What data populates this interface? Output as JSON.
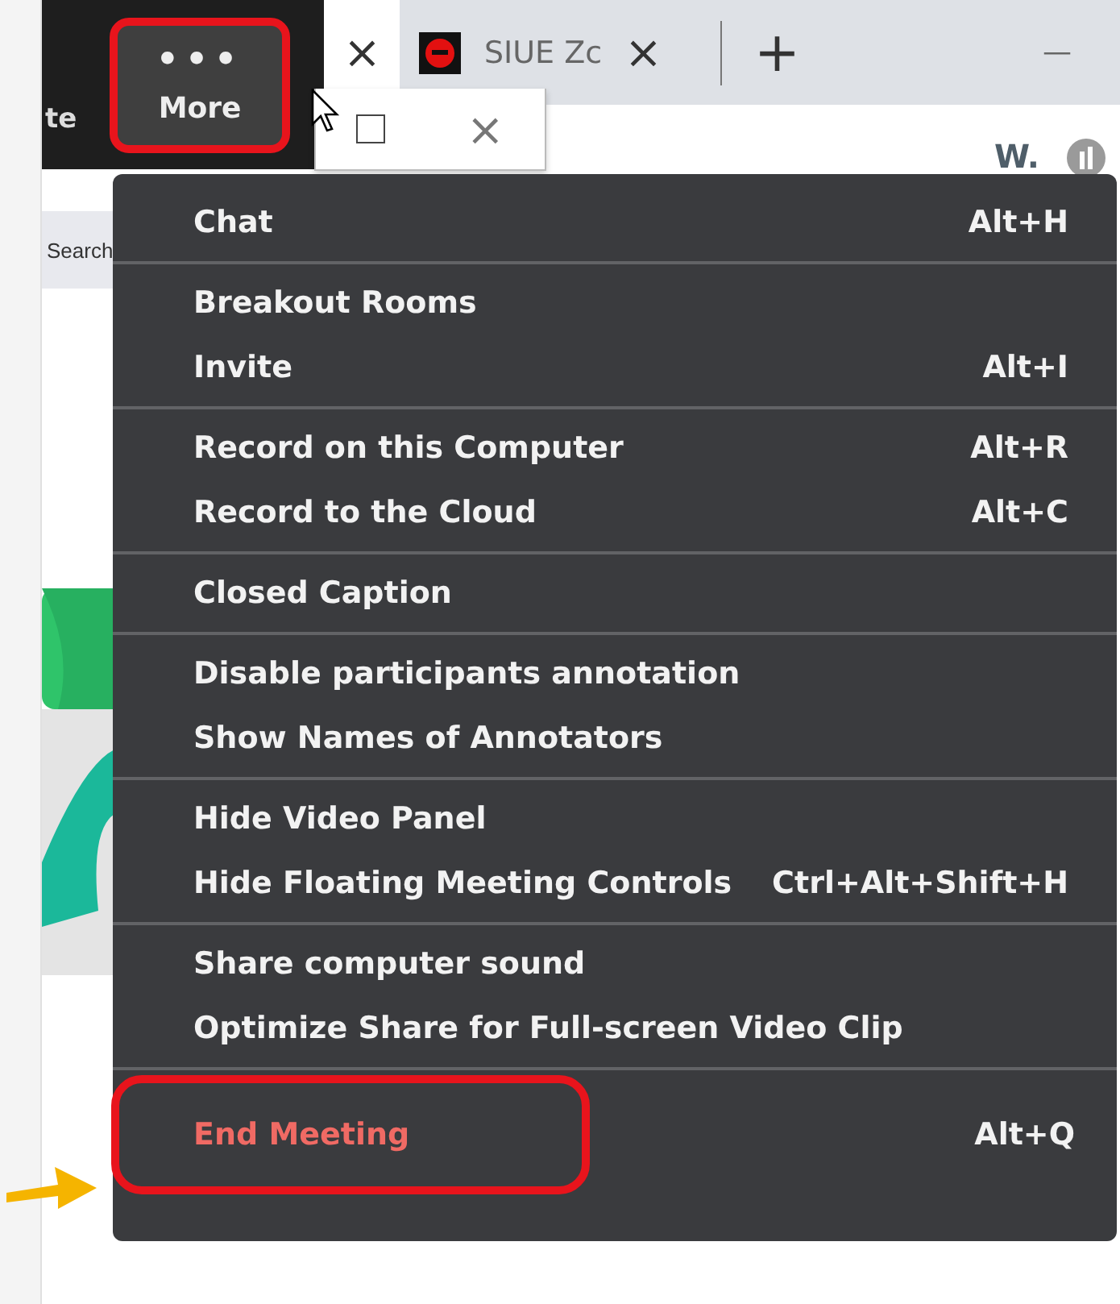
{
  "meeting_toolbar": {
    "partial_label": "te",
    "more_button": {
      "icon": "•••",
      "label": "More",
      "annotated": true
    }
  },
  "tabs": [
    {
      "close": "×",
      "selected": true
    },
    {
      "title": "SIUE Zc",
      "close": "×",
      "selected": false
    }
  ],
  "new_tab": "+",
  "minimize": "—",
  "popup": {
    "close": "×"
  },
  "toolbar": {
    "extension_label": "W."
  },
  "bookmarks": {
    "search": "Search"
  },
  "menu": {
    "groups": [
      [
        {
          "label": "Chat",
          "shortcut": "Alt+H",
          "kind": "normal",
          "annotated": false
        }
      ],
      [
        {
          "label": "Breakout Rooms",
          "kind": "normal",
          "annotated": false
        },
        {
          "label": "Invite",
          "shortcut": "Alt+I",
          "kind": "normal",
          "annotated": false
        }
      ],
      [
        {
          "label": "Record on this Computer",
          "shortcut": "Alt+R",
          "kind": "normal",
          "annotated": false
        },
        {
          "label": "Record to the Cloud",
          "shortcut": "Alt+C",
          "kind": "normal",
          "annotated": false
        }
      ],
      [
        {
          "label": "Closed Caption",
          "kind": "normal",
          "annotated": false
        }
      ],
      [
        {
          "label": "Disable participants annotation",
          "kind": "normal",
          "annotated": false
        },
        {
          "label": "Show Names of Annotators",
          "kind": "normal",
          "annotated": false
        }
      ],
      [
        {
          "label": "Hide Video Panel",
          "kind": "normal",
          "annotated": false
        },
        {
          "label": "Hide Floating Meeting Controls",
          "shortcut": "Ctrl+Alt+Shift+H",
          "kind": "normal",
          "annotated": false
        }
      ],
      [
        {
          "label": "Share computer sound",
          "kind": "normal",
          "annotated": false
        },
        {
          "label": "Optimize Share for Full-screen Video Clip",
          "kind": "normal",
          "annotated": false
        }
      ],
      [
        {
          "label": "End Meeting",
          "shortcut": "Alt+Q",
          "kind": "danger",
          "annotated": true
        }
      ]
    ]
  }
}
